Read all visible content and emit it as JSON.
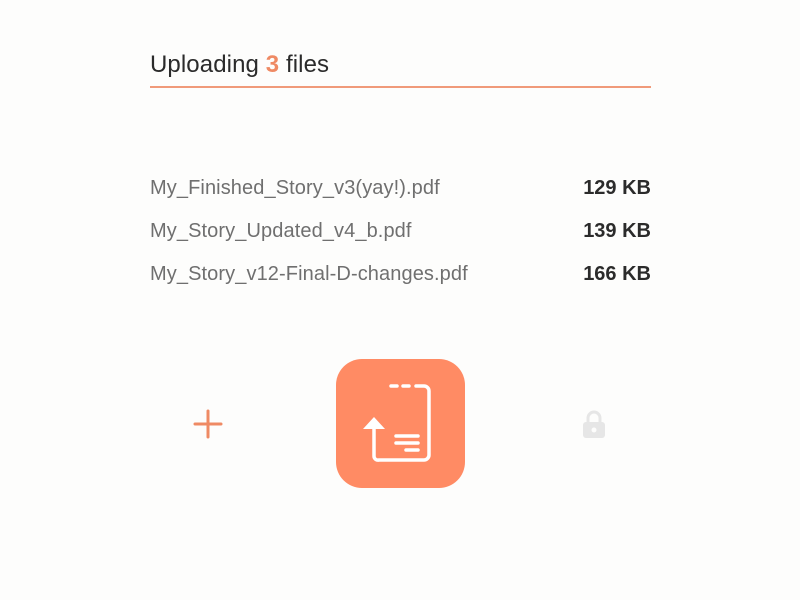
{
  "header": {
    "title_prefix": "Uploading ",
    "file_count": "3",
    "title_suffix": " files"
  },
  "files": [
    {
      "name": "My_Finished_Story_v3(yay!).pdf",
      "size": "129 KB"
    },
    {
      "name": "My_Story_Updated_v4_b.pdf",
      "size": "139 KB"
    },
    {
      "name": "My_Story_v12-Final-D-changes.pdf",
      "size": "166 KB"
    }
  ],
  "actions": {
    "add_icon": "plus-icon",
    "upload_icon": "file-upload-icon",
    "lock_icon": "lock-icon"
  },
  "colors": {
    "accent": "#ff8b64",
    "accent_text": "#ef8a64",
    "divider": "#f09a7a",
    "text_dark": "#2b2b2b",
    "text_muted": "#6f6f6f",
    "icon_disabled": "#e6e6e6"
  }
}
